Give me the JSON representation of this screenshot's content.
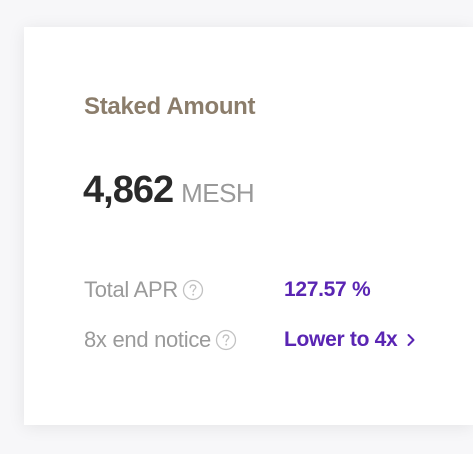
{
  "card": {
    "title": "Staked Amount",
    "amount": {
      "value": "4,862",
      "unit": "MESH"
    },
    "rows": [
      {
        "label": "Total APR",
        "value": "127.57 %",
        "help_icon": "question-circle-icon"
      },
      {
        "label": "8x end notice",
        "value": "Lower to 4x",
        "help_icon": "question-circle-icon",
        "link_icon": "chevron-right-icon"
      }
    ]
  },
  "colors": {
    "background": "#f7f7f9",
    "card": "#ffffff",
    "title": "#8b7d6b",
    "amount": "#2a2a2a",
    "muted": "#9a9a9a",
    "accent": "#5a25b3"
  }
}
